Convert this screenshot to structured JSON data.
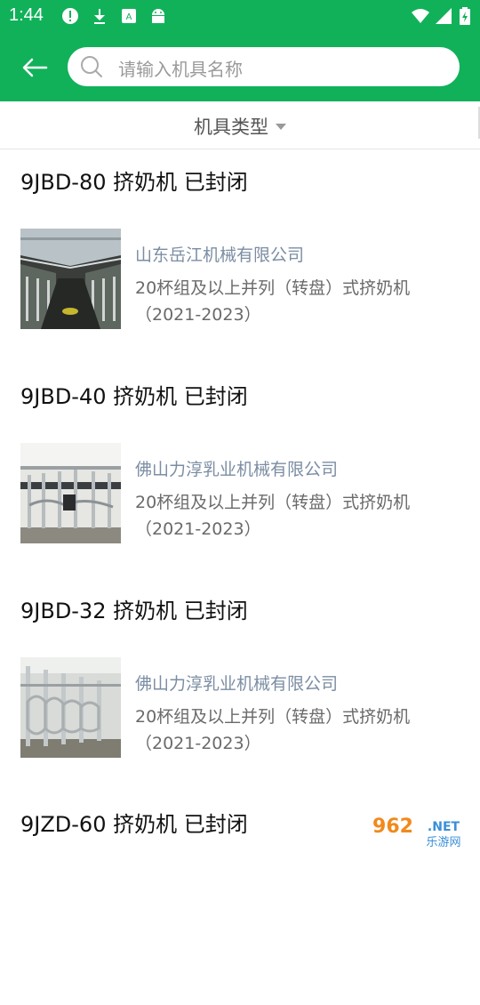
{
  "status": {
    "time": "1:44"
  },
  "search": {
    "placeholder": "请输入机具名称"
  },
  "filter": {
    "label": "机具类型"
  },
  "items": [
    {
      "title": "9JBD-80 挤奶机 已封闭",
      "company": "山东岳江机械有限公司",
      "type": "20杯组及以上并列（转盘）式挤奶机",
      "years": "（2021-2023）"
    },
    {
      "title": "9JBD-40 挤奶机 已封闭",
      "company": "佛山力淳乳业机械有限公司",
      "type": "20杯组及以上并列（转盘）式挤奶机",
      "years": "（2021-2023）"
    },
    {
      "title": "9JBD-32 挤奶机 已封闭",
      "company": "佛山力淳乳业机械有限公司",
      "type": "20杯组及以上并列（转盘）式挤奶机",
      "years": "（2021-2023）"
    },
    {
      "title": "9JZD-60 挤奶机 已封闭"
    }
  ],
  "watermark": {
    "brand": "962.NET",
    "sub": "乐游网"
  },
  "colors": {
    "primary": "#11b15a",
    "company_text": "#7b8da3",
    "body_text": "#6a6a6a"
  }
}
